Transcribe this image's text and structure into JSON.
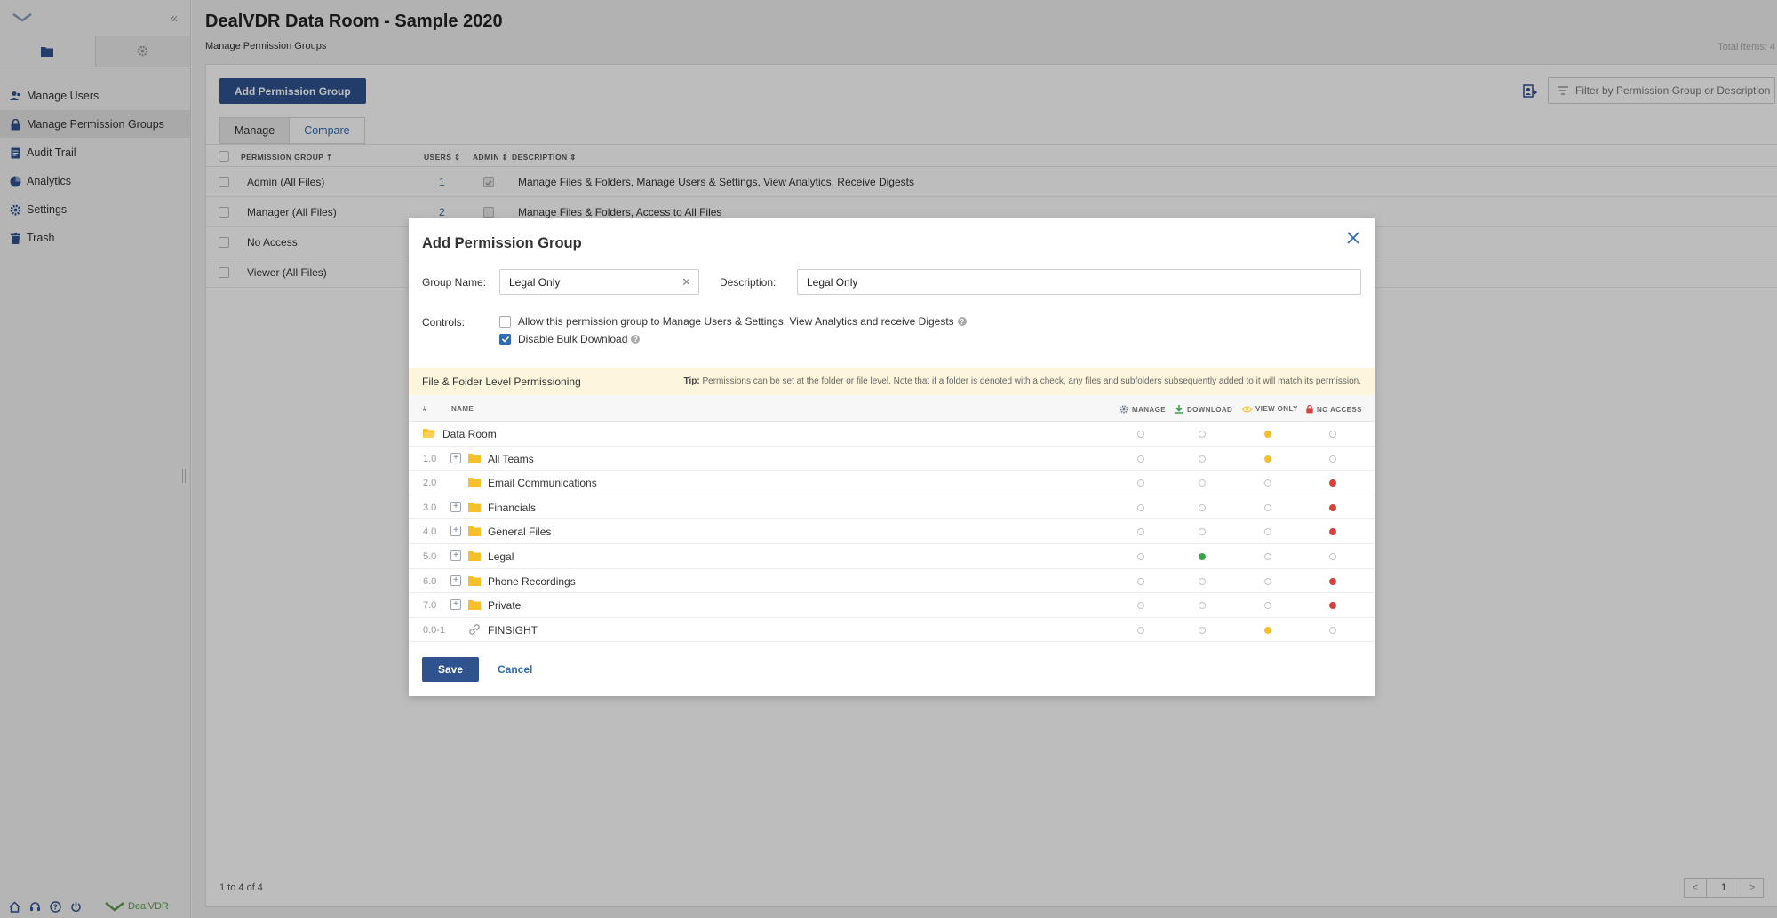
{
  "sidebar": {
    "nav": [
      {
        "label": "Manage Users",
        "icon": "users-icon"
      },
      {
        "label": "Manage Permission Groups",
        "icon": "lock-icon"
      },
      {
        "label": "Audit Trail",
        "icon": "document-icon"
      },
      {
        "label": "Analytics",
        "icon": "pie-chart-icon"
      },
      {
        "label": "Settings",
        "icon": "gear-icon"
      },
      {
        "label": "Trash",
        "icon": "trash-icon"
      }
    ],
    "brand": "DealVDR"
  },
  "header": {
    "title": "DealVDR Data Room - Sample 2020",
    "subtitle": "Manage Permission Groups",
    "total_items": "Total items: 4"
  },
  "toolbar": {
    "add_label": "Add Permission Group",
    "filter_placeholder": "Filter by Permission Group or Description"
  },
  "tabs": [
    "Manage",
    "Compare"
  ],
  "table": {
    "headers": {
      "group": "PERMISSION GROUP ⇡",
      "users": "USERS ⇕",
      "admin": "ADMIN ⇕",
      "description": "DESCRIPTION ⇕"
    },
    "rows": [
      {
        "name": "Admin (All Files)",
        "users": "1",
        "admin": true,
        "description": "Manage Files & Folders, Manage Users & Settings, View Analytics, Receive Digests"
      },
      {
        "name": "Manager (All Files)",
        "users": "2",
        "admin": false,
        "description": "Manage Files & Folders, Access to All Files"
      },
      {
        "name": "No Access",
        "users": "",
        "admin": false,
        "description": ""
      },
      {
        "name": "Viewer (All Files)",
        "users": "",
        "admin": false,
        "description": ""
      }
    ]
  },
  "footer": {
    "range": "1 to 4 of 4",
    "page": "1",
    "prev": "<",
    "next": ">"
  },
  "modal": {
    "title": "Add Permission Group",
    "group_name_label": "Group Name:",
    "group_name_value": "Legal Only",
    "description_label": "Description:",
    "description_value": "Legal Only",
    "controls_label": "Controls:",
    "controls": [
      {
        "label": "Allow this permission group to Manage Users & Settings, View Analytics and receive Digests",
        "checked": false
      },
      {
        "label": "Disable Bulk Download",
        "checked": true
      }
    ],
    "banner_title": "File & Folder Level Permissioning",
    "tip_bold": "Tip:",
    "tip_text": "Permissions can be set at the folder or file level. Note that if a folder is denoted with a check, any files and subfolders subsequently added to it will match its permission.",
    "columns": {
      "num": "#",
      "name": "NAME",
      "manage": "MANAGE",
      "download": "DOWNLOAD",
      "view_only": "VIEW ONLY",
      "no_access": "NO ACCESS"
    },
    "items": [
      {
        "num": "",
        "name": "Data Room",
        "type": "folder-open",
        "expandable": false,
        "perm": "view_only"
      },
      {
        "num": "1.0",
        "name": "All Teams",
        "type": "folder",
        "expandable": true,
        "perm": "view_only"
      },
      {
        "num": "2.0",
        "name": "Email Communications",
        "type": "folder",
        "expandable": false,
        "perm": "no_access"
      },
      {
        "num": "3.0",
        "name": "Financials",
        "type": "folder",
        "expandable": true,
        "perm": "no_access"
      },
      {
        "num": "4.0",
        "name": "General Files",
        "type": "folder",
        "expandable": true,
        "perm": "no_access"
      },
      {
        "num": "5.0",
        "name": "Legal",
        "type": "folder",
        "expandable": true,
        "perm": "download"
      },
      {
        "num": "6.0",
        "name": "Phone Recordings",
        "type": "folder",
        "expandable": true,
        "perm": "no_access"
      },
      {
        "num": "7.0",
        "name": "Private",
        "type": "folder",
        "expandable": true,
        "perm": "no_access"
      },
      {
        "num": "0.0-1",
        "name": "FINSIGHT",
        "type": "link",
        "expandable": false,
        "perm": "view_only"
      }
    ],
    "save_label": "Save",
    "cancel_label": "Cancel"
  },
  "colors": {
    "primary": "#2f538f",
    "link": "#2f6bb0",
    "view_only": "#f6c02b",
    "no_access": "#d9423a",
    "download": "#3aa34a",
    "banner": "#fdf6dc"
  }
}
